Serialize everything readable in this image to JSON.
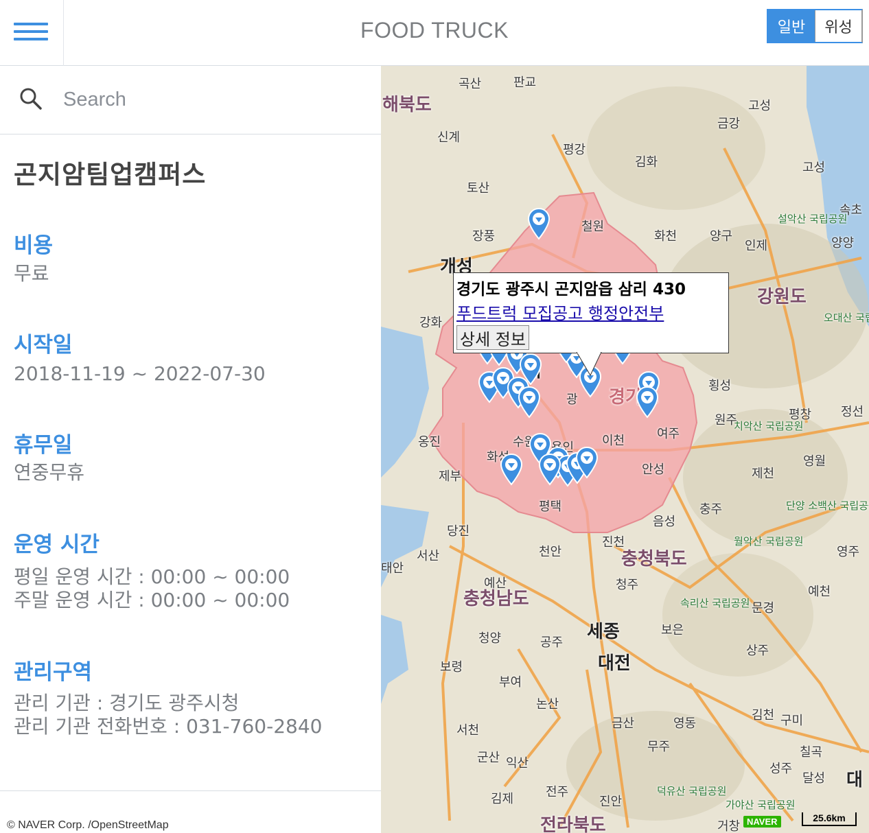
{
  "header": {
    "title": "FOOD TRUCK",
    "map_type_general": "일반",
    "map_type_satellite": "위성",
    "menu_icon": "hamburger-menu-icon"
  },
  "search": {
    "placeholder": "Search",
    "icon": "search-icon"
  },
  "detail": {
    "name": "곤지암팀업캠퍼스",
    "cost_label": "비용",
    "cost_value": "무료",
    "start_label": "시작일",
    "start_value": "2018-11-19 ~ 2022-07-30",
    "holiday_label": "휴무일",
    "holiday_value": "연중무휴",
    "hours_label": "운영 시간",
    "hours_weekday": "평일 운영 시간 : 00:00 ~ 00:00",
    "hours_weekend": "주말 운영 시간 : 00:00 ~ 00:00",
    "area_label": "관리구역",
    "area_agency": "관리 기관 : 경기도 광주시청",
    "area_phone": "관리 기관 전화번호 : 031-760-2840"
  },
  "copyright": "© NAVER Corp. /OpenStreetMap",
  "map": {
    "infowindow": {
      "address": "경기도 광주시 곤지암읍 삼리 430",
      "link": "푸드트럭 모집공고 행정안전부",
      "detail_button": "상세 정보"
    },
    "scale": "25.6km",
    "logo": "NAVER",
    "region_color": "#f4a3a8",
    "marker_color": "#3d8fe0",
    "labels": {
      "gokgsan": "곡산",
      "pangyo": "판교",
      "hwanghae": "해북도",
      "singye": "신계",
      "pyeonggang": "평강",
      "gimhwa": "김화",
      "goseong1": "고성",
      "geumgang": "금강",
      "goseong2": "고성",
      "tosan": "토산",
      "jangpung": "장풍",
      "hwacheon": "화천",
      "yanggu": "양구",
      "inje": "인제",
      "seorak": "설악산 국립공원",
      "sokcho": "속초",
      "yangyang": "양양",
      "gaeseong": "개성",
      "gangwon": "강원도",
      "odaesan": "오대산 국립공원",
      "hoengseong": "횡성",
      "pyeongchang": "평창",
      "jeongseon": "정선",
      "wonju": "원주",
      "chiaksan": "치악산 국립공원",
      "yeongwol": "영월",
      "jecheon": "제천",
      "danyang": "단양 소백산 국립공원",
      "chungju": "충주",
      "eumseong": "음성",
      "jincheon": "진천",
      "chungbuk": "충청북도",
      "woraksan": "월악산 국립공원",
      "yeongju": "영주",
      "cheonan": "천안",
      "dangjin": "당진",
      "seosan": "서산",
      "taean": "태안",
      "yesan": "예산",
      "chungnam": "충청남도",
      "cheongju": "청주",
      "songnisan": "속리산 국립공원",
      "mungyeong": "문경",
      "yecheon": "예천",
      "boeun": "보은",
      "sejong": "세종",
      "sangju": "상주",
      "cheongyang": "청양",
      "gongju": "공주",
      "boryeong": "보령",
      "daejeon": "대전",
      "buyeo": "부여",
      "nonsan": "논산",
      "geumsan": "금산",
      "yeongdong": "영동",
      "gimcheon": "김천",
      "gumi": "구미",
      "seocheon": "서천",
      "gunsan": "군산",
      "iksan": "익산",
      "muju": "무주",
      "chilgok": "칠곡",
      "seongju": "성주",
      "dalseong": "달성",
      "daegu": "대",
      "gimje": "김제",
      "jeonju": "전주",
      "jinan": "진안",
      "deogyusan": "덕유산 국립공원",
      "gayasan": "가야산 국립공원",
      "geochang": "거창",
      "jeonbuk": "전라북도",
      "gyeonggi": "경기도",
      "icheon": "이천",
      "yongin": "용인",
      "suwon": "수원",
      "yeoju": "여주",
      "gwangju": "광",
      "seoul": "서",
      "jebu": "제부",
      "anseong": "안성",
      "pyeongtaek": "평택",
      "hwaseong": "화성",
      "ongjin": "옹진",
      "ganghwa": "강화",
      "cheorwon": "철원"
    }
  }
}
